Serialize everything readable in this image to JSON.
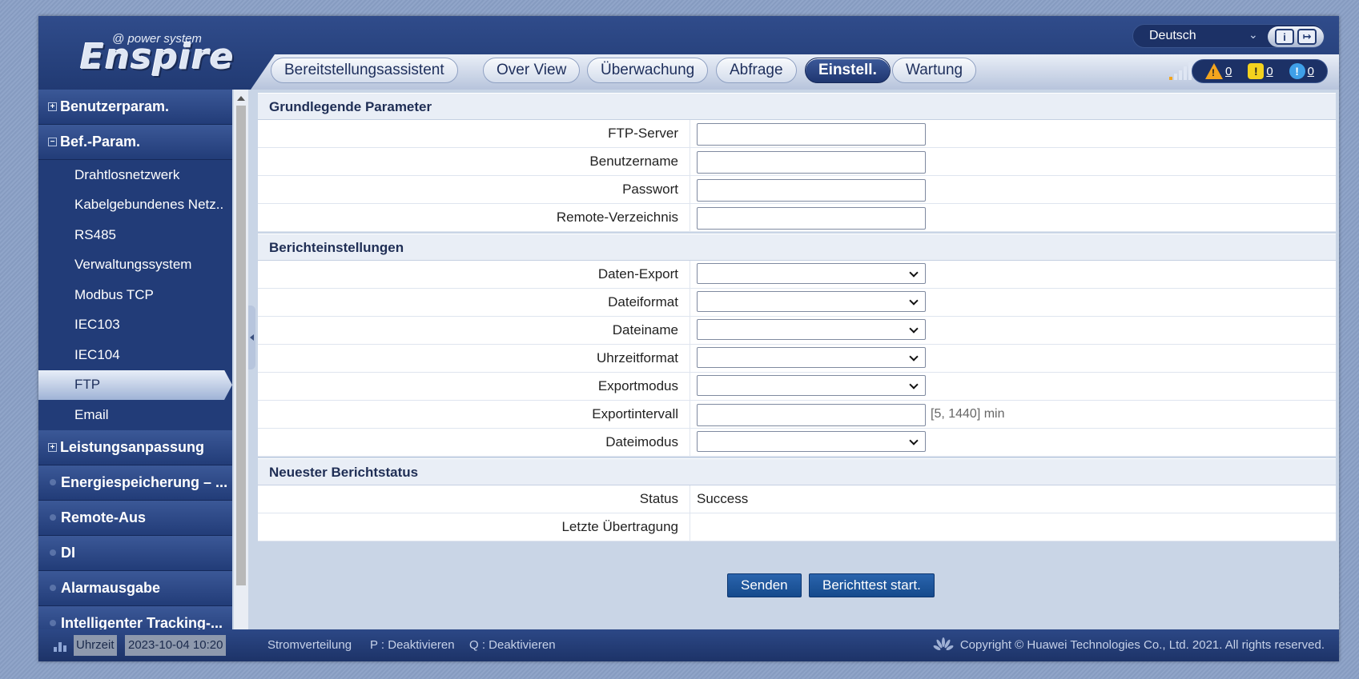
{
  "logo": {
    "sub": "@ power system",
    "main": "Enspire"
  },
  "language": {
    "selected": "Deutsch"
  },
  "header_buttons": {
    "info_glyph": "i",
    "logout_glyph": "↦"
  },
  "nav": {
    "tabs": [
      {
        "label": "Bereitstellungsassistent"
      },
      {
        "label": "Over View"
      },
      {
        "label": "Überwachung"
      },
      {
        "label": "Abfrage"
      },
      {
        "label": "Einstell."
      },
      {
        "label": "Wartung"
      }
    ],
    "active": "Einstell."
  },
  "alarms": {
    "major": "0",
    "minor": "0",
    "warning": "0"
  },
  "sidebar": {
    "groups": [
      {
        "label": "Benutzerparam.",
        "marker": "+"
      },
      {
        "label": "Bef.-Param.",
        "marker": "−"
      }
    ],
    "subitems": [
      "Drahtlosnetzwerk",
      "Kabelgebundenes Netz..",
      "RS485",
      "Verwaltungssystem",
      "Modbus TCP",
      "IEC103",
      "IEC104",
      "FTP",
      "Email"
    ],
    "active_subitem": "FTP",
    "groups_after": [
      {
        "label": "Leistungsanpassung",
        "marker": "+"
      },
      {
        "label": "Energiespeicherung – ...",
        "marker": "dot"
      },
      {
        "label": "Remote-Aus",
        "marker": "dot"
      },
      {
        "label": "DI",
        "marker": "dot"
      },
      {
        "label": "Alarmausgabe",
        "marker": "dot"
      },
      {
        "label": "Intelligenter Tracking-...",
        "marker": "dot"
      }
    ]
  },
  "sections": {
    "basic": {
      "title": "Grundlegende Parameter",
      "fields": [
        {
          "label": "FTP-Server",
          "value": ""
        },
        {
          "label": "Benutzername",
          "value": ""
        },
        {
          "label": "Passwort",
          "value": ""
        },
        {
          "label": "Remote-Verzeichnis",
          "value": ""
        }
      ]
    },
    "report": {
      "title": "Berichteinstellungen",
      "fields": [
        {
          "label": "Daten-Export",
          "type": "select",
          "value": ""
        },
        {
          "label": "Dateiformat",
          "type": "select",
          "value": ""
        },
        {
          "label": "Dateiname",
          "type": "select",
          "value": ""
        },
        {
          "label": "Uhrzeitformat",
          "type": "select",
          "value": ""
        },
        {
          "label": "Exportmodus",
          "type": "select",
          "value": ""
        },
        {
          "label": "Exportintervall",
          "type": "input",
          "value": "",
          "unit": "[5, 1440] min"
        },
        {
          "label": "Dateimodus",
          "type": "select",
          "value": ""
        }
      ]
    },
    "status": {
      "title": "Neuester Berichtstatus",
      "fields": [
        {
          "label": "Status",
          "value": "Success"
        },
        {
          "label": "Letzte Übertragung",
          "value": ""
        }
      ]
    }
  },
  "buttons": {
    "send": "Senden",
    "test": "Berichttest start."
  },
  "footer": {
    "time_label": "Uhrzeit",
    "time_value": "2023-10-04 10:20",
    "distribution": "Stromverteilung",
    "p_status": "P : Deaktivieren",
    "q_status": "Q : Deaktivieren",
    "copyright": "Copyright © Huawei Technologies Co., Ltd. 2021. All rights reserved."
  },
  "colors": {
    "header": "#213a73",
    "active_tab": "#1f3670",
    "button": "#1f5aa0",
    "sidebar": "#223c78"
  }
}
